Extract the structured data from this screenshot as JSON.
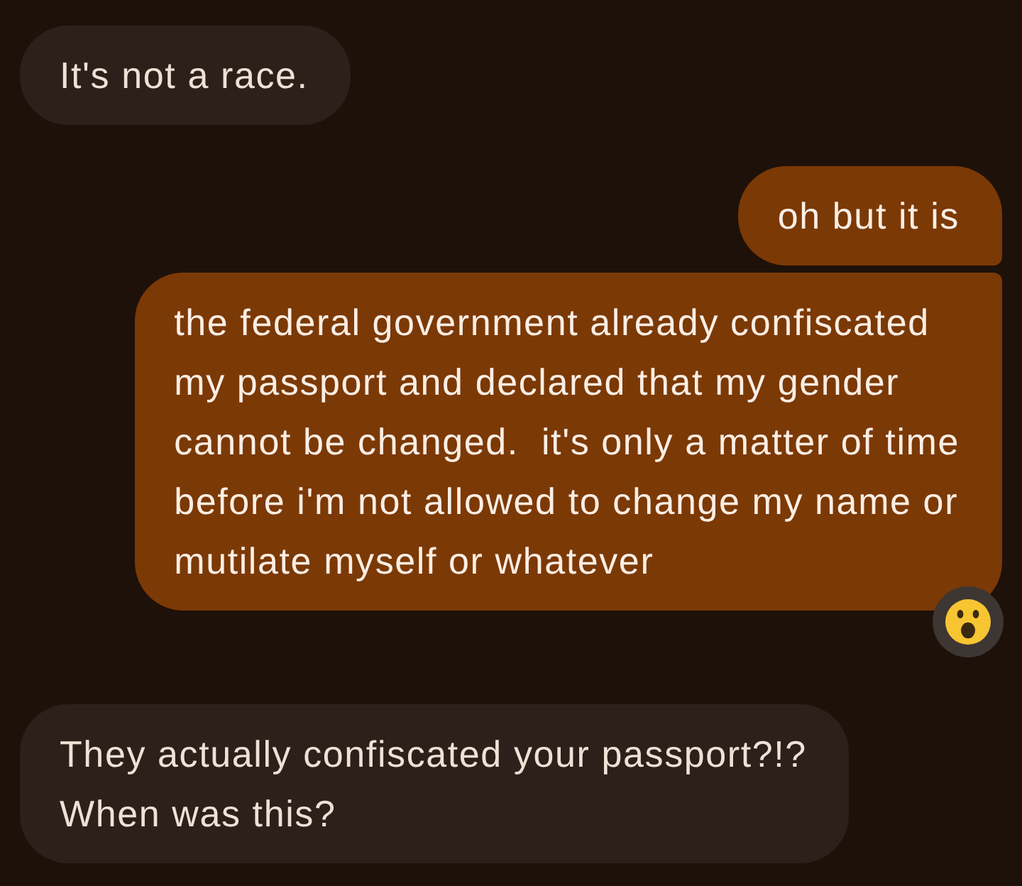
{
  "messages": [
    {
      "kind": "incoming",
      "lines": [
        "It's not a race."
      ],
      "reacted": false
    },
    {
      "kind": "outgoing",
      "lines": [
        "oh but it is"
      ],
      "reacted": false
    },
    {
      "kind": "outgoing",
      "lines": [
        "the federal government already confiscated",
        "my passport and declared that my gender",
        "cannot be changed.  it's only a matter of time",
        "before i'm not allowed to change my name or",
        "mutilate myself or whatever"
      ],
      "reacted": true
    },
    {
      "kind": "incoming",
      "lines": [
        "They actually confiscated your passport?!?",
        "When was this?"
      ],
      "reacted": false
    }
  ]
}
